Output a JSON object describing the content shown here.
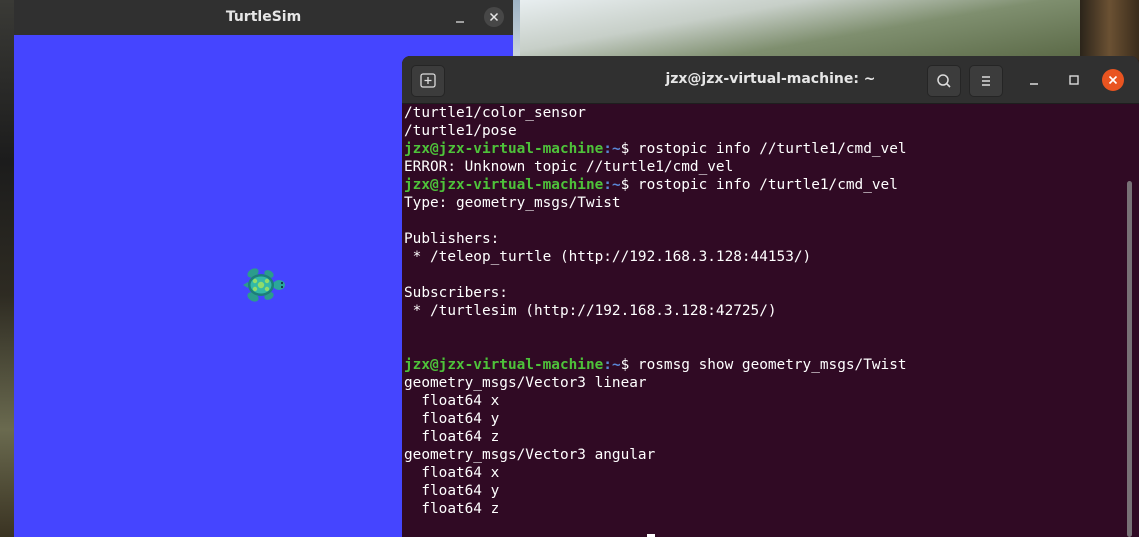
{
  "turtlesim": {
    "title": "TurtleSim",
    "minimize_label": "–",
    "close_label": "✕",
    "background_color": "#4545ff"
  },
  "terminal": {
    "title": "jzx@jzx-virtual-machine: ~",
    "minimize_label": "–",
    "close_label": "✕",
    "prompt_user": "jzx@jzx-virtual-machine",
    "prompt_path": ":~",
    "lines": [
      {
        "type": "text",
        "text": "/turtle1/color_sensor"
      },
      {
        "type": "text",
        "text": "/turtle1/pose"
      },
      {
        "type": "prompt",
        "cmd": "$ rostopic info //turtle1/cmd_vel"
      },
      {
        "type": "text",
        "text": "ERROR: Unknown topic //turtle1/cmd_vel"
      },
      {
        "type": "prompt",
        "cmd": "$ rostopic info /turtle1/cmd_vel"
      },
      {
        "type": "text",
        "text": "Type: geometry_msgs/Twist"
      },
      {
        "type": "text",
        "text": ""
      },
      {
        "type": "text",
        "text": "Publishers:"
      },
      {
        "type": "text",
        "text": " * /teleop_turtle (http://192.168.3.128:44153/)"
      },
      {
        "type": "text",
        "text": ""
      },
      {
        "type": "text",
        "text": "Subscribers:"
      },
      {
        "type": "text",
        "text": " * /turtlesim (http://192.168.3.128:42725/)"
      },
      {
        "type": "text",
        "text": ""
      },
      {
        "type": "text",
        "text": ""
      },
      {
        "type": "prompt",
        "cmd": "$ rosmsg show geometry_msgs/Twist"
      },
      {
        "type": "text",
        "text": "geometry_msgs/Vector3 linear"
      },
      {
        "type": "text",
        "text": "  float64 x"
      },
      {
        "type": "text",
        "text": "  float64 y"
      },
      {
        "type": "text",
        "text": "  float64 z"
      },
      {
        "type": "text",
        "text": "geometry_msgs/Vector3 angular"
      },
      {
        "type": "text",
        "text": "  float64 x"
      },
      {
        "type": "text",
        "text": "  float64 y"
      },
      {
        "type": "text",
        "text": "  float64 z"
      }
    ],
    "colors": {
      "background": "#300a24",
      "prompt_user": "#4ec23a",
      "prompt_path": "#5a86d6",
      "close_button": "#e95420"
    }
  },
  "icons": [
    "new-tab-icon",
    "search-icon",
    "hamburger-menu-icon",
    "minimize-icon",
    "maximize-icon",
    "close-icon",
    "turtle-icon"
  ]
}
